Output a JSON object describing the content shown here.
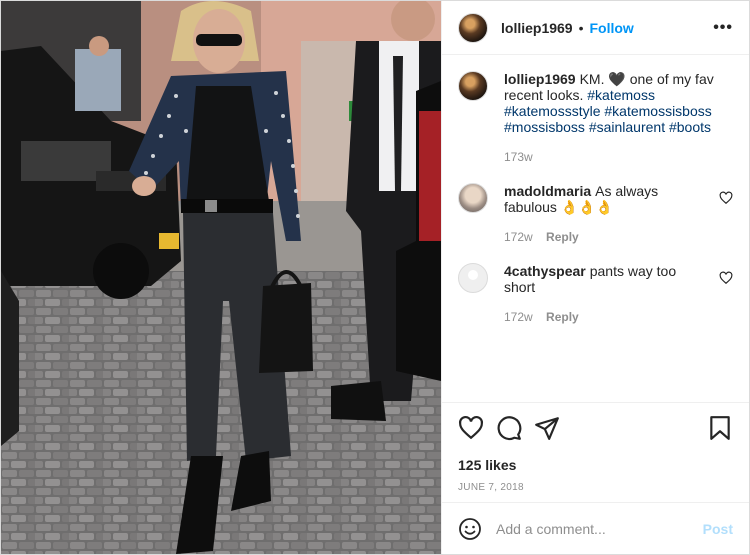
{
  "header": {
    "username": "lolliep1969",
    "dot": "•",
    "follow_label": "Follow",
    "more_label": "•••"
  },
  "caption": {
    "username": "lolliep1969",
    "text": "KM. 🖤 one of my fav recent looks.",
    "hashtags": [
      "#katemoss",
      "#katemossstyle",
      "#katemossisboss",
      "#mossisboss",
      "#sainlaurent",
      "#boots"
    ],
    "time": "173w"
  },
  "comments": [
    {
      "username": "madoldmaria",
      "text": "As always fabulous 👌👌👌",
      "time": "172w",
      "reply_label": "Reply"
    },
    {
      "username": "4cathyspear",
      "text": "pants way too short",
      "time": "172w",
      "reply_label": "Reply"
    }
  ],
  "likes_text": "125 likes",
  "date_text": "June 7, 2018",
  "add_comment": {
    "placeholder": "Add a comment...",
    "post_label": "Post"
  },
  "icons": [
    "heart-icon",
    "comment-icon",
    "share-icon",
    "bookmark-icon",
    "emoji-icon",
    "more-icon"
  ]
}
